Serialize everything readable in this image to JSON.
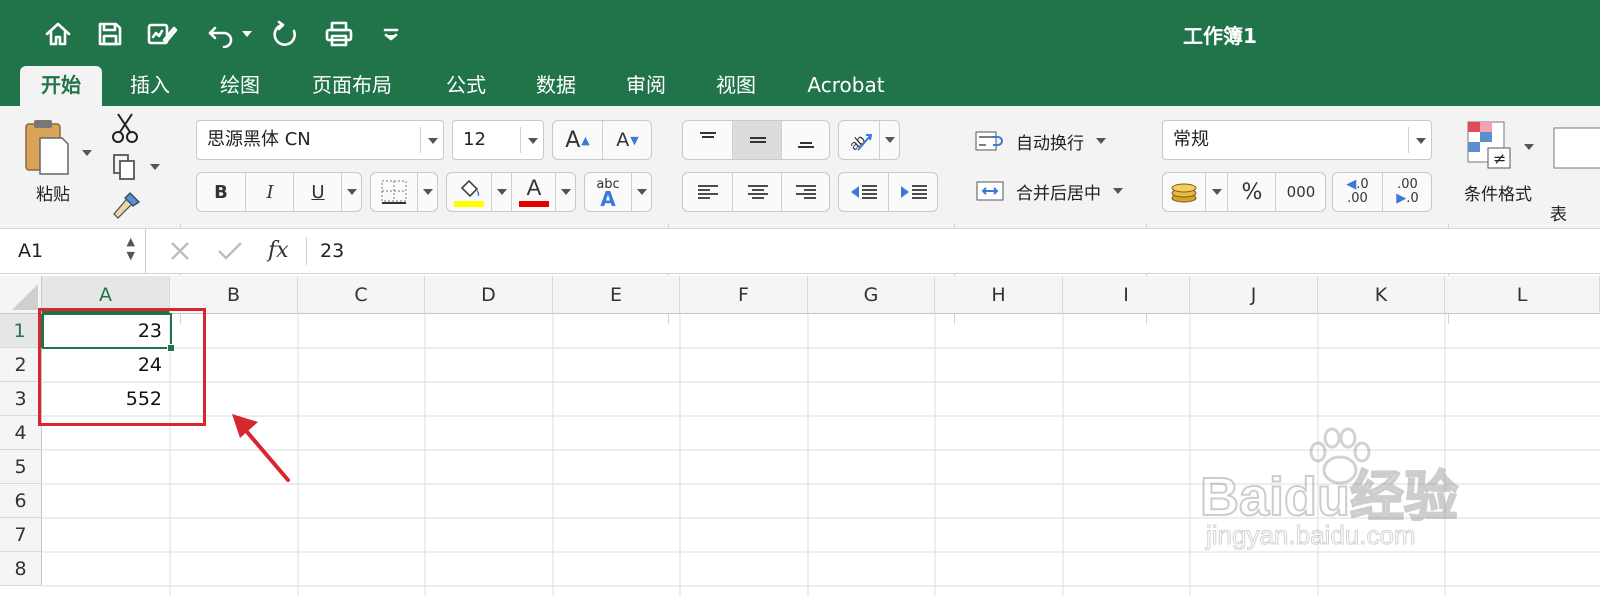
{
  "window": {
    "title": "工作簿1"
  },
  "quick_access": [
    "home-icon",
    "save-icon",
    "edit-icon",
    "undo-icon",
    "redo-icon",
    "print-icon",
    "customize-icon"
  ],
  "tabs": [
    {
      "label": "开始",
      "active": true
    },
    {
      "label": "插入"
    },
    {
      "label": "绘图"
    },
    {
      "label": "页面布局"
    },
    {
      "label": "公式"
    },
    {
      "label": "数据"
    },
    {
      "label": "审阅"
    },
    {
      "label": "视图"
    },
    {
      "label": "Acrobat"
    }
  ],
  "ribbon": {
    "paste_label": "粘贴",
    "font_name": "思源黑体 CN",
    "font_size": "12",
    "bold": "B",
    "italic": "I",
    "underline": "U",
    "wrap_text": "自动换行",
    "merge_center": "合并后居中",
    "number_format": "常规",
    "percent": "%",
    "thousands": "000",
    "increase_decimal_a": ".0",
    "increase_decimal_b": ".00",
    "decrease_decimal_a": ".00",
    "decrease_decimal_b": ".0",
    "conditional_format": "条件格式",
    "table_partial": "表",
    "text_abc": "abc",
    "colors": {
      "fill": "#ffff00",
      "font": "#e00000",
      "accent": "#21734a"
    }
  },
  "formula_bar": {
    "name_box": "A1",
    "fx": "fx",
    "content": "23"
  },
  "sheet": {
    "columns": [
      "A",
      "B",
      "C",
      "D",
      "E",
      "F",
      "G",
      "H",
      "I",
      "J",
      "K",
      "L"
    ],
    "rows": [
      "1",
      "2",
      "3",
      "4",
      "5",
      "6",
      "7",
      "8"
    ],
    "cells": {
      "A1": "23",
      "A2": "24",
      "A3": "552"
    },
    "active_cell": "A1"
  },
  "watermark": {
    "brand": "Baidu经验",
    "url": "jingyan.baidu.com"
  }
}
